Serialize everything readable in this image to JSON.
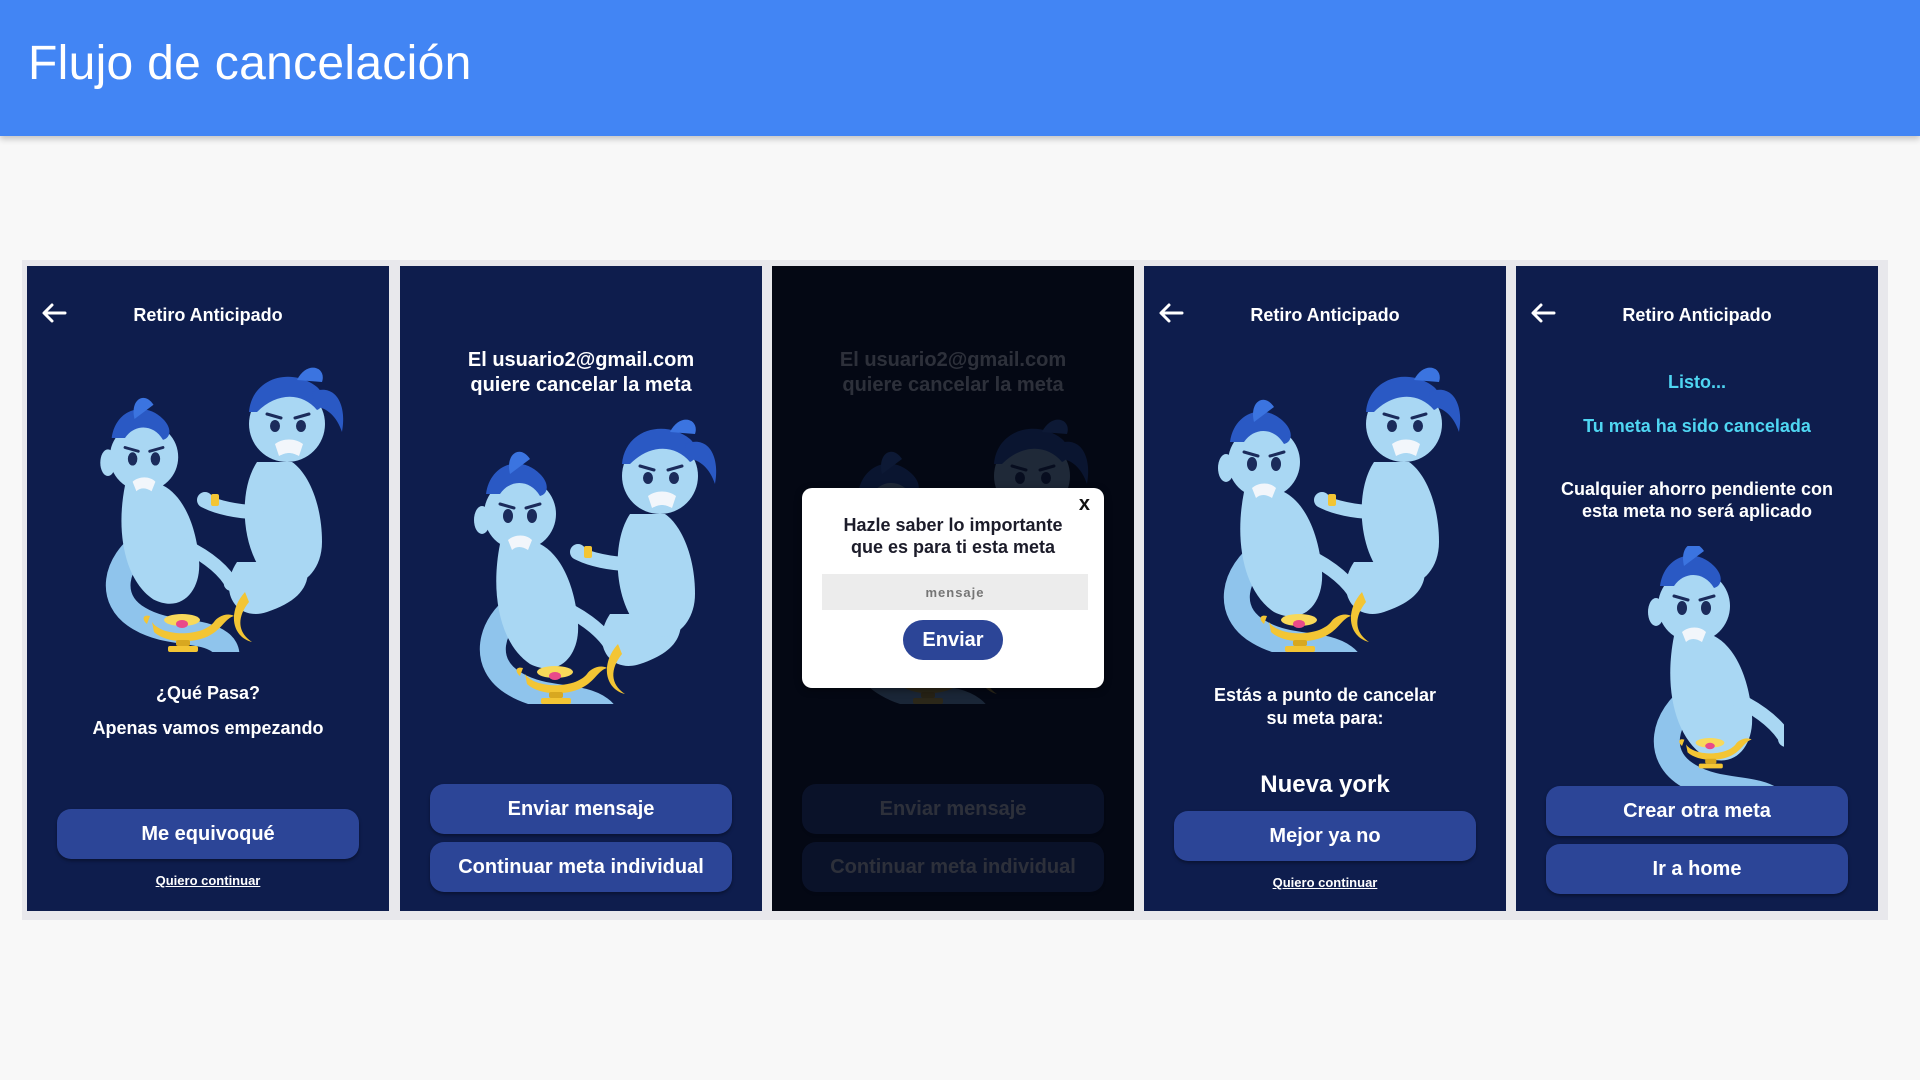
{
  "page": {
    "title": "Flujo de cancelación"
  },
  "screens": [
    {
      "header_title": "Retiro Anticipado",
      "question": "¿Qué Pasa?",
      "subtitle": "Apenas vamos empezando",
      "primary_button": "Me equivoqué",
      "link": "Quiero continuar"
    },
    {
      "message_line1": "El usuario2@gmail.com",
      "message_line2": "quiere cancelar la meta",
      "button_1": "Enviar mensaje",
      "button_2": "Continuar meta individual"
    },
    {
      "message_line1": "El usuario2@gmail.com",
      "message_line2": "quiere cancelar la meta",
      "button_1": "Enviar mensaje",
      "button_2": "Continuar meta individual",
      "dialog": {
        "close": "x",
        "text_line1": "Hazle saber lo importante",
        "text_line2": "que es para ti esta meta",
        "input_placeholder": "mensaje",
        "send_button": "Enviar"
      }
    },
    {
      "header_title": "Retiro Anticipado",
      "text_line1": "Estás a punto de cancelar",
      "text_line2": "su meta para:",
      "goal_name": "Nueva york",
      "primary_button": "Mejor ya no",
      "link": "Quiero continuar"
    },
    {
      "header_title": "Retiro Anticipado",
      "status": "Listo...",
      "status_detail": "Tu meta ha sido cancelada",
      "note_line1": "Cualquier ahorro pendiente con",
      "note_line2": "esta meta no será aplicado",
      "button_1": "Crear otra meta",
      "button_2": "Ir a home"
    }
  ],
  "colors": {
    "app_bar": "#4285f4",
    "screen_bg": "#0e1d4d",
    "button": "#2c4597",
    "accent_cyan": "#4fd6f2",
    "genie_body": "#a9d7f3",
    "genie_hair": "#2a59c4",
    "lamp": "#f3c534"
  }
}
